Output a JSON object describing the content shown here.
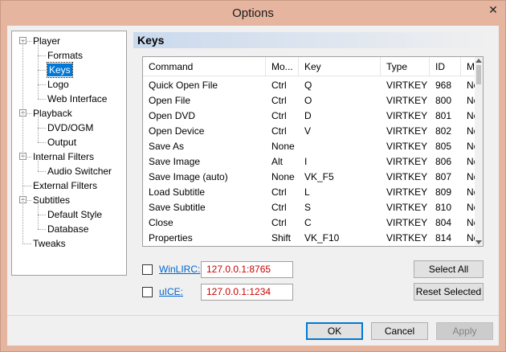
{
  "window": {
    "title": "Options",
    "close_glyph": "✕"
  },
  "tree": [
    {
      "label": "Player",
      "level": 0,
      "expander": "−"
    },
    {
      "label": "Formats",
      "level": 1
    },
    {
      "label": "Keys",
      "level": 1,
      "selected": true
    },
    {
      "label": "Logo",
      "level": 1
    },
    {
      "label": "Web Interface",
      "level": 1
    },
    {
      "label": "Playback",
      "level": 0,
      "expander": "−"
    },
    {
      "label": "DVD/OGM",
      "level": 1
    },
    {
      "label": "Output",
      "level": 1
    },
    {
      "label": "Internal Filters",
      "level": 0,
      "expander": "−"
    },
    {
      "label": "Audio Switcher",
      "level": 1
    },
    {
      "label": "External Filters",
      "level": 0
    },
    {
      "label": "Subtitles",
      "level": 0,
      "expander": "−"
    },
    {
      "label": "Default Style",
      "level": 1
    },
    {
      "label": "Database",
      "level": 1
    },
    {
      "label": "Tweaks",
      "level": 0
    }
  ],
  "page": {
    "title": "Keys"
  },
  "keys_table": {
    "columns": [
      "Command",
      "Mo...",
      "Key",
      "Type",
      "ID",
      "Mo"
    ],
    "rows": [
      [
        "Quick Open File",
        "Ctrl",
        "Q",
        "VIRTKEY",
        "968",
        "No"
      ],
      [
        "Open File",
        "Ctrl",
        "O",
        "VIRTKEY",
        "800",
        "No"
      ],
      [
        "Open DVD",
        "Ctrl",
        "D",
        "VIRTKEY",
        "801",
        "No"
      ],
      [
        "Open Device",
        "Ctrl",
        "V",
        "VIRTKEY",
        "802",
        "No"
      ],
      [
        "Save As",
        "None",
        "",
        "VIRTKEY",
        "805",
        "No"
      ],
      [
        "Save Image",
        "Alt",
        "I",
        "VIRTKEY",
        "806",
        "No"
      ],
      [
        "Save Image (auto)",
        "None",
        "VK_F5",
        "VIRTKEY",
        "807",
        "No"
      ],
      [
        "Load Subtitle",
        "Ctrl",
        "L",
        "VIRTKEY",
        "809",
        "No"
      ],
      [
        "Save Subtitle",
        "Ctrl",
        "S",
        "VIRTKEY",
        "810",
        "No"
      ],
      [
        "Close",
        "Ctrl",
        "C",
        "VIRTKEY",
        "804",
        "No"
      ],
      [
        "Properties",
        "Shift",
        "VK_F10",
        "VIRTKEY",
        "814",
        "No"
      ]
    ]
  },
  "winlirc": {
    "label": "WinLIRC:",
    "value": "127.0.0.1:8765",
    "checked": false
  },
  "uice": {
    "label": "uICE:",
    "value": "127.0.0.1:1234",
    "checked": false
  },
  "buttons": {
    "select_all": "Select All",
    "reset_selected": "Reset Selected",
    "ok": "OK",
    "cancel": "Cancel",
    "apply": "Apply"
  },
  "colors": {
    "titlebar": "#e6b59f",
    "selection": "#0078d7",
    "link": "#0066cc",
    "field_text": "#cc0000"
  }
}
